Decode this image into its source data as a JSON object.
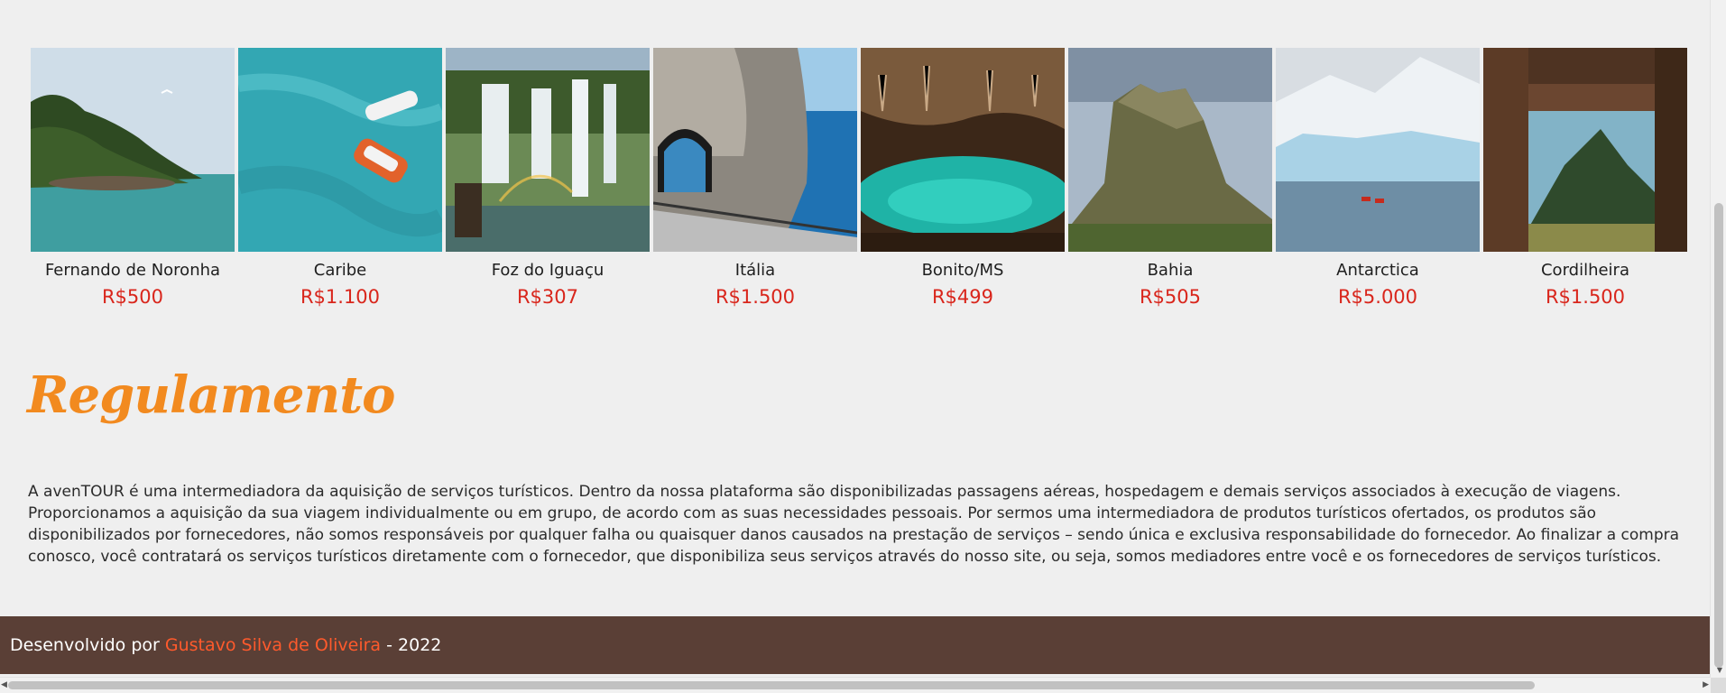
{
  "destinations": [
    {
      "name": "Fernando de Noronha",
      "price": "R$500"
    },
    {
      "name": "Caribe",
      "price": "R$1.100"
    },
    {
      "name": "Foz do Iguaçu",
      "price": "R$307"
    },
    {
      "name": "Itália",
      "price": "R$1.500"
    },
    {
      "name": "Bonito/MS",
      "price": "R$499"
    },
    {
      "name": "Bahia",
      "price": "R$505"
    },
    {
      "name": "Antarctica",
      "price": "R$5.000"
    },
    {
      "name": "Cordilheira",
      "price": "R$1.500"
    }
  ],
  "regulamento": {
    "title": "Regulamento",
    "text": "A avenTOUR é uma intermediadora da aquisição de serviços turísticos. Dentro da nossa plataforma são disponibilizadas passagens aéreas, hospedagem e demais serviços associados à execução de viagens. Proporcionamos a aquisição da sua viagem individualmente ou em grupo, de acordo com as suas necessidades pessoais. Por sermos uma intermediadora de produtos turísticos ofertados, os produtos são disponibilizados por fornecedores, não somos responsáveis por qualquer falha ou quaisquer danos causados na prestação de serviços – sendo única e exclusiva responsabilidade do fornecedor. Ao finalizar a compra conosco, você contratará os serviços turísticos diretamente com o fornecedor, que disponibiliza seus serviços através do nosso site, ou seja, somos mediadores entre você e os fornecedores de serviços turísticos."
  },
  "footer": {
    "prefix": "Desenvolvido por ",
    "author": "Gustavo Silva de Oliveira",
    "suffix": " - 2022"
  },
  "colors": {
    "price": "#d9261c",
    "title": "#f28a1f",
    "footer_bg": "#5a3f36",
    "author": "#ff5a2c"
  }
}
